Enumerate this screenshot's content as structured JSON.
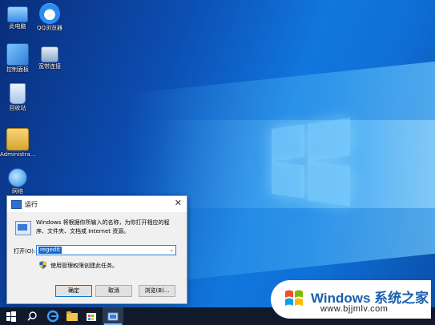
{
  "desktop_icons": [
    {
      "label": "此电脑",
      "icon": "computer-icon"
    },
    {
      "label": "QQ浏览器",
      "icon": "qq-browser-icon"
    },
    {
      "label": "控制面板",
      "icon": "control-panel-icon"
    },
    {
      "label": "宽带连接",
      "icon": "network-icon"
    },
    {
      "label": "回收站",
      "icon": "recycle-bin-icon"
    },
    {
      "label": "Administra...",
      "icon": "user-folder-icon"
    },
    {
      "label": "网络",
      "icon": "network-globe-icon"
    }
  ],
  "run_dialog": {
    "title": "运行",
    "description": "Windows 将根据你所输入的名称，为你打开相应的程序、文件夹、文档或 Internet 资源。",
    "open_label": "打开(O):",
    "input_value": "regedit",
    "admin_note": "使用管理权限创建此任务。",
    "buttons": {
      "ok": "确定",
      "cancel": "取消",
      "browse": "浏览(B)..."
    }
  },
  "taskbar": {
    "items": [
      "windows-start-icon",
      "search-icon",
      "edge-icon",
      "file-explorer-icon",
      "store-icon",
      "run-app-icon"
    ]
  },
  "watermark": {
    "title": "Windows 系统之家",
    "url": "www.bjjmlv.com"
  },
  "colors": {
    "desktop_blue": "#0c4fb4",
    "selection_blue": "#0f68d6",
    "taskbar": "#101a2a",
    "watermark_blue": "#1b5fb0"
  }
}
